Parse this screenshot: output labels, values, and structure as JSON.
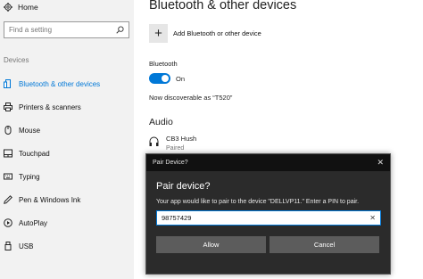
{
  "sidebar": {
    "home_label": "Home",
    "search_placeholder": "Find a setting",
    "section_heading": "Devices",
    "items": [
      {
        "label": "Bluetooth & other devices",
        "icon": "bluetooth-icon",
        "active": true
      },
      {
        "label": "Printers & scanners",
        "icon": "printer-icon",
        "active": false
      },
      {
        "label": "Mouse",
        "icon": "mouse-icon",
        "active": false
      },
      {
        "label": "Touchpad",
        "icon": "touchpad-icon",
        "active": false
      },
      {
        "label": "Typing",
        "icon": "keyboard-icon",
        "active": false
      },
      {
        "label": "Pen & Windows Ink",
        "icon": "pen-icon",
        "active": false
      },
      {
        "label": "AutoPlay",
        "icon": "autoplay-icon",
        "active": false
      },
      {
        "label": "USB",
        "icon": "usb-icon",
        "active": false
      }
    ]
  },
  "main": {
    "title": "Bluetooth & other devices",
    "add_label": "Add Bluetooth or other device",
    "bluetooth_label": "Bluetooth",
    "toggle_state": "On",
    "discoverable_text": "Now discoverable as “T520”",
    "audio_heading": "Audio",
    "audio_device": {
      "name": "CB3 Hush",
      "status": "Paired"
    }
  },
  "dialog": {
    "window_title": "Pair Device?",
    "heading": "Pair device?",
    "message": "Your app would like to pair to the device \"DELLVP11.\" Enter a PIN to pair.",
    "pin_value": "98757429",
    "allow_label": "Allow",
    "cancel_label": "Cancel"
  },
  "colors": {
    "accent": "#0078d7",
    "sidebar_bg": "#f2f2f2",
    "dialog_bg": "#2b2b2b",
    "dialog_titlebar": "#111111",
    "button_bg": "#5c5c5c"
  }
}
